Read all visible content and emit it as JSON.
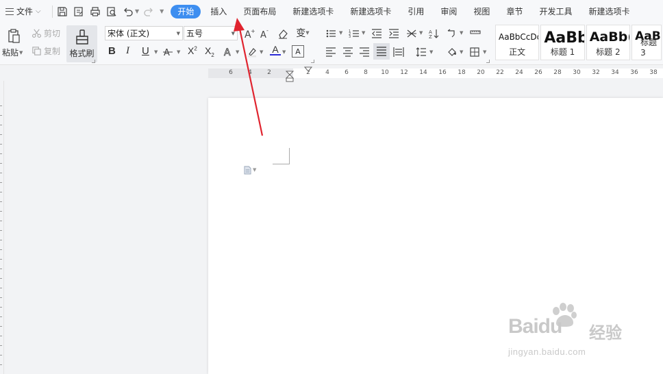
{
  "menubar": {
    "file_label": "文件",
    "tabs": [
      "开始",
      "插入",
      "页面布局",
      "新建选项卡",
      "新建选项卡",
      "引用",
      "审阅",
      "视图",
      "章节",
      "开发工具",
      "新建选项卡"
    ],
    "active_tab_color": "#3d8ef0"
  },
  "ribbon": {
    "paste_label": "粘贴",
    "cut_label": "剪切",
    "copy_label": "复制",
    "format_painter_label": "格式刷",
    "font_name": "宋体 (正文)",
    "font_size": "五号",
    "styles": [
      {
        "sample": "AaBbCcDd",
        "name": "正文"
      },
      {
        "sample": "AaBb",
        "name": "标题 1"
      },
      {
        "sample": "AaBb(",
        "name": "标题 2"
      },
      {
        "sample": "AaBb",
        "name": "标题 3"
      }
    ],
    "bold_label": "B",
    "italic_label": "I",
    "underline_label": "U",
    "font_color_label": "A",
    "font_color": "#2b2bd6"
  },
  "ruler": {
    "ticks": [
      "6",
      "4",
      "2",
      "2",
      "4",
      "6",
      "8",
      "10",
      "12",
      "14",
      "16",
      "18",
      "20",
      "22",
      "24",
      "26",
      "28",
      "30",
      "32",
      "34",
      "36",
      "38"
    ]
  },
  "watermark": {
    "brand": "Baidu",
    "brand_cn": "经验",
    "url": "jingyan.baidu.com"
  },
  "annotation_color": "#e0242f"
}
